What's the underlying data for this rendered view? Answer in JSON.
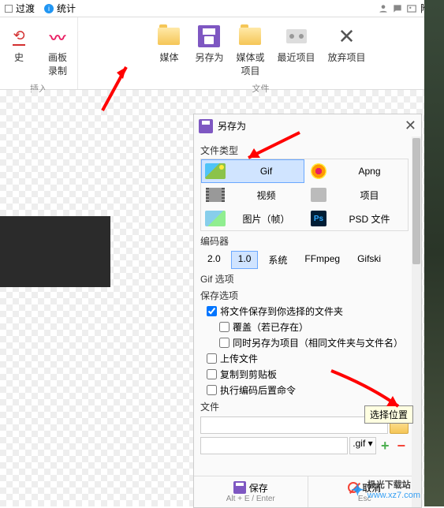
{
  "topbar": {
    "tab1": "过渡",
    "tab2": "统计",
    "attach": "附加"
  },
  "ribbon": {
    "group1_label": "插入",
    "group2_label": "文件",
    "btn_history": "史",
    "btn_canvas_line1": "画板",
    "btn_canvas_line2": "录制",
    "btn_media": "媒体",
    "btn_saveas": "另存为",
    "btn_mediaproj_line1": "媒体或",
    "btn_mediaproj_line2": "项目",
    "btn_recent": "最近项目",
    "btn_discard": "放弃项目"
  },
  "panel": {
    "title": "另存为",
    "file_type_label": "文件类型",
    "types": {
      "gif": "Gif",
      "apng": "Apng",
      "video": "视频",
      "project": "项目",
      "image": "图片（帧）",
      "psd": "PSD 文件"
    },
    "encoder_label": "编码器",
    "encoders": {
      "e1": "2.0",
      "e2": "1.0",
      "e3": "系统",
      "e4": "FFmpeg",
      "e5": "Gifski"
    },
    "gif_options": "Gif 选项",
    "save_options": "保存选项",
    "opt_save_to_folder": "将文件保存到你选择的文件夹",
    "opt_overwrite": "覆盖（若已存在）",
    "opt_save_project": "同时另存为项目（相同文件夹与文件名）",
    "opt_upload": "上传文件",
    "opt_clipboard": "复制到剪贴板",
    "opt_post_cmd": "执行编码后置命令",
    "file_label": "文件",
    "ext": ".gif",
    "tooltip": "选择位置",
    "btn_save": "保存",
    "btn_save_hint": "Alt + E / Enter",
    "btn_cancel": "取消",
    "btn_cancel_hint": "Esc"
  },
  "watermark": {
    "name": "极光下载站",
    "url": "www.xz7.com"
  }
}
